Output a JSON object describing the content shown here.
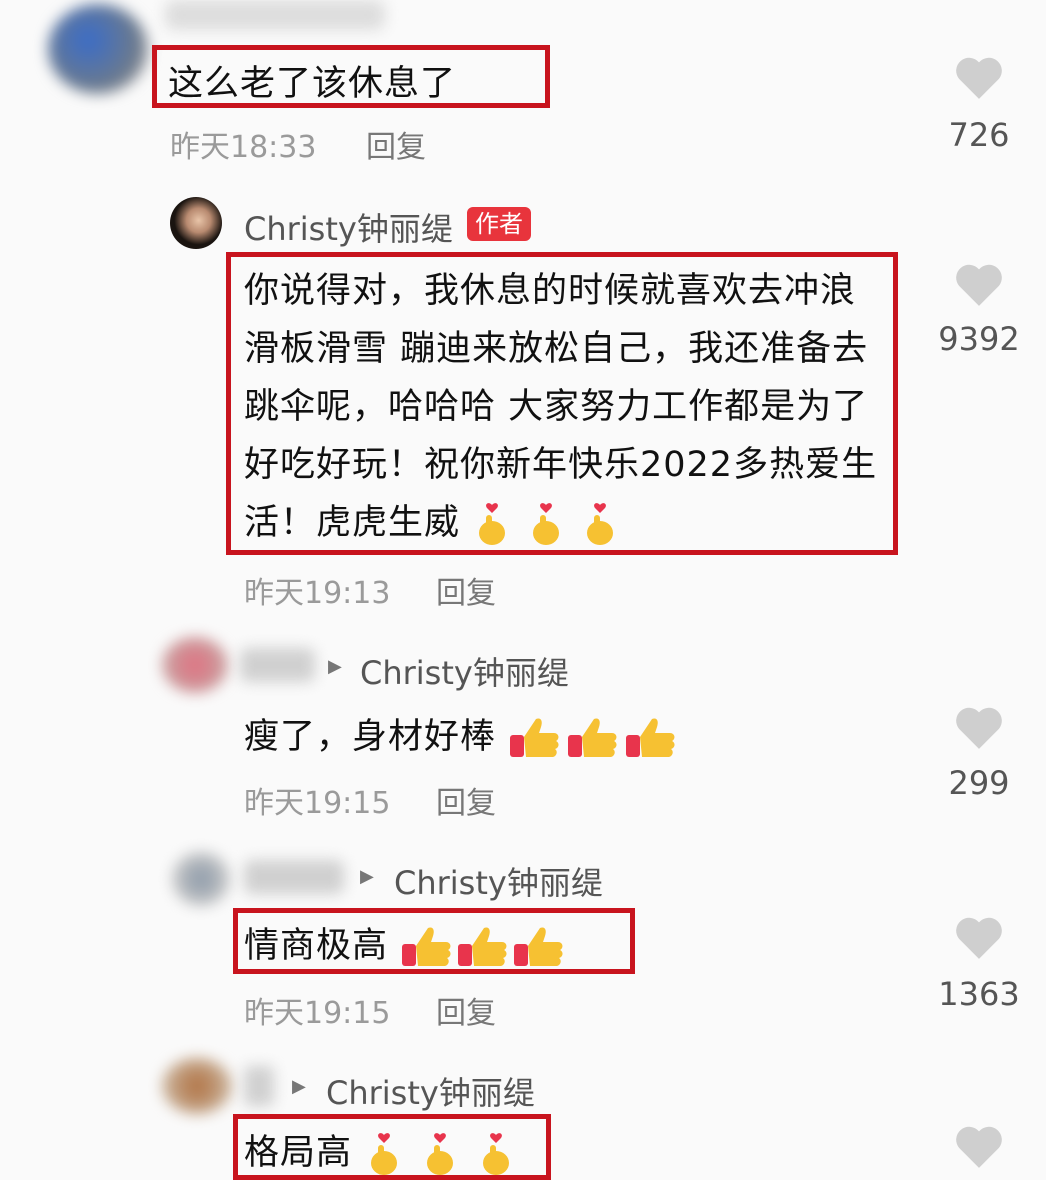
{
  "comments": [
    {
      "text": "这么老了该休息了",
      "time": "昨天18:33",
      "reply": "回复",
      "likes": "726"
    },
    {
      "author": "Christy钟丽缇",
      "badge": "作者",
      "lines": [
        "你说得对，我休息的时候就喜欢去冲浪",
        "滑板滑雪 蹦迪来放松自己，我还准备去",
        "跳伞呢，哈哈哈 大家努力工作都是为了",
        "好吃好玩！祝你新年快乐2022多热爱生",
        "活！虎虎生威"
      ],
      "time": "昨天19:13",
      "reply": "回复",
      "likes": "9392"
    },
    {
      "reply_to": "Christy钟丽缇",
      "text": "瘦了，身材好棒",
      "time": "昨天19:15",
      "reply": "回复",
      "likes": "299"
    },
    {
      "reply_to": "Christy钟丽缇",
      "text": "情商极高",
      "time": "昨天19:15",
      "reply": "回复",
      "likes": "1363"
    },
    {
      "reply_to": "Christy钟丽缇",
      "text": "格局高"
    }
  ],
  "icons": {
    "like": "heart-icon",
    "finger_heart": "finger-heart-emoji",
    "thumbs_up": "thumbs-up-emoji",
    "arrow": "reply-arrow-icon"
  },
  "colors": {
    "highlight_box": "#c8141e",
    "author_badge": "#e8343c",
    "heart": "#cfcfcf"
  }
}
